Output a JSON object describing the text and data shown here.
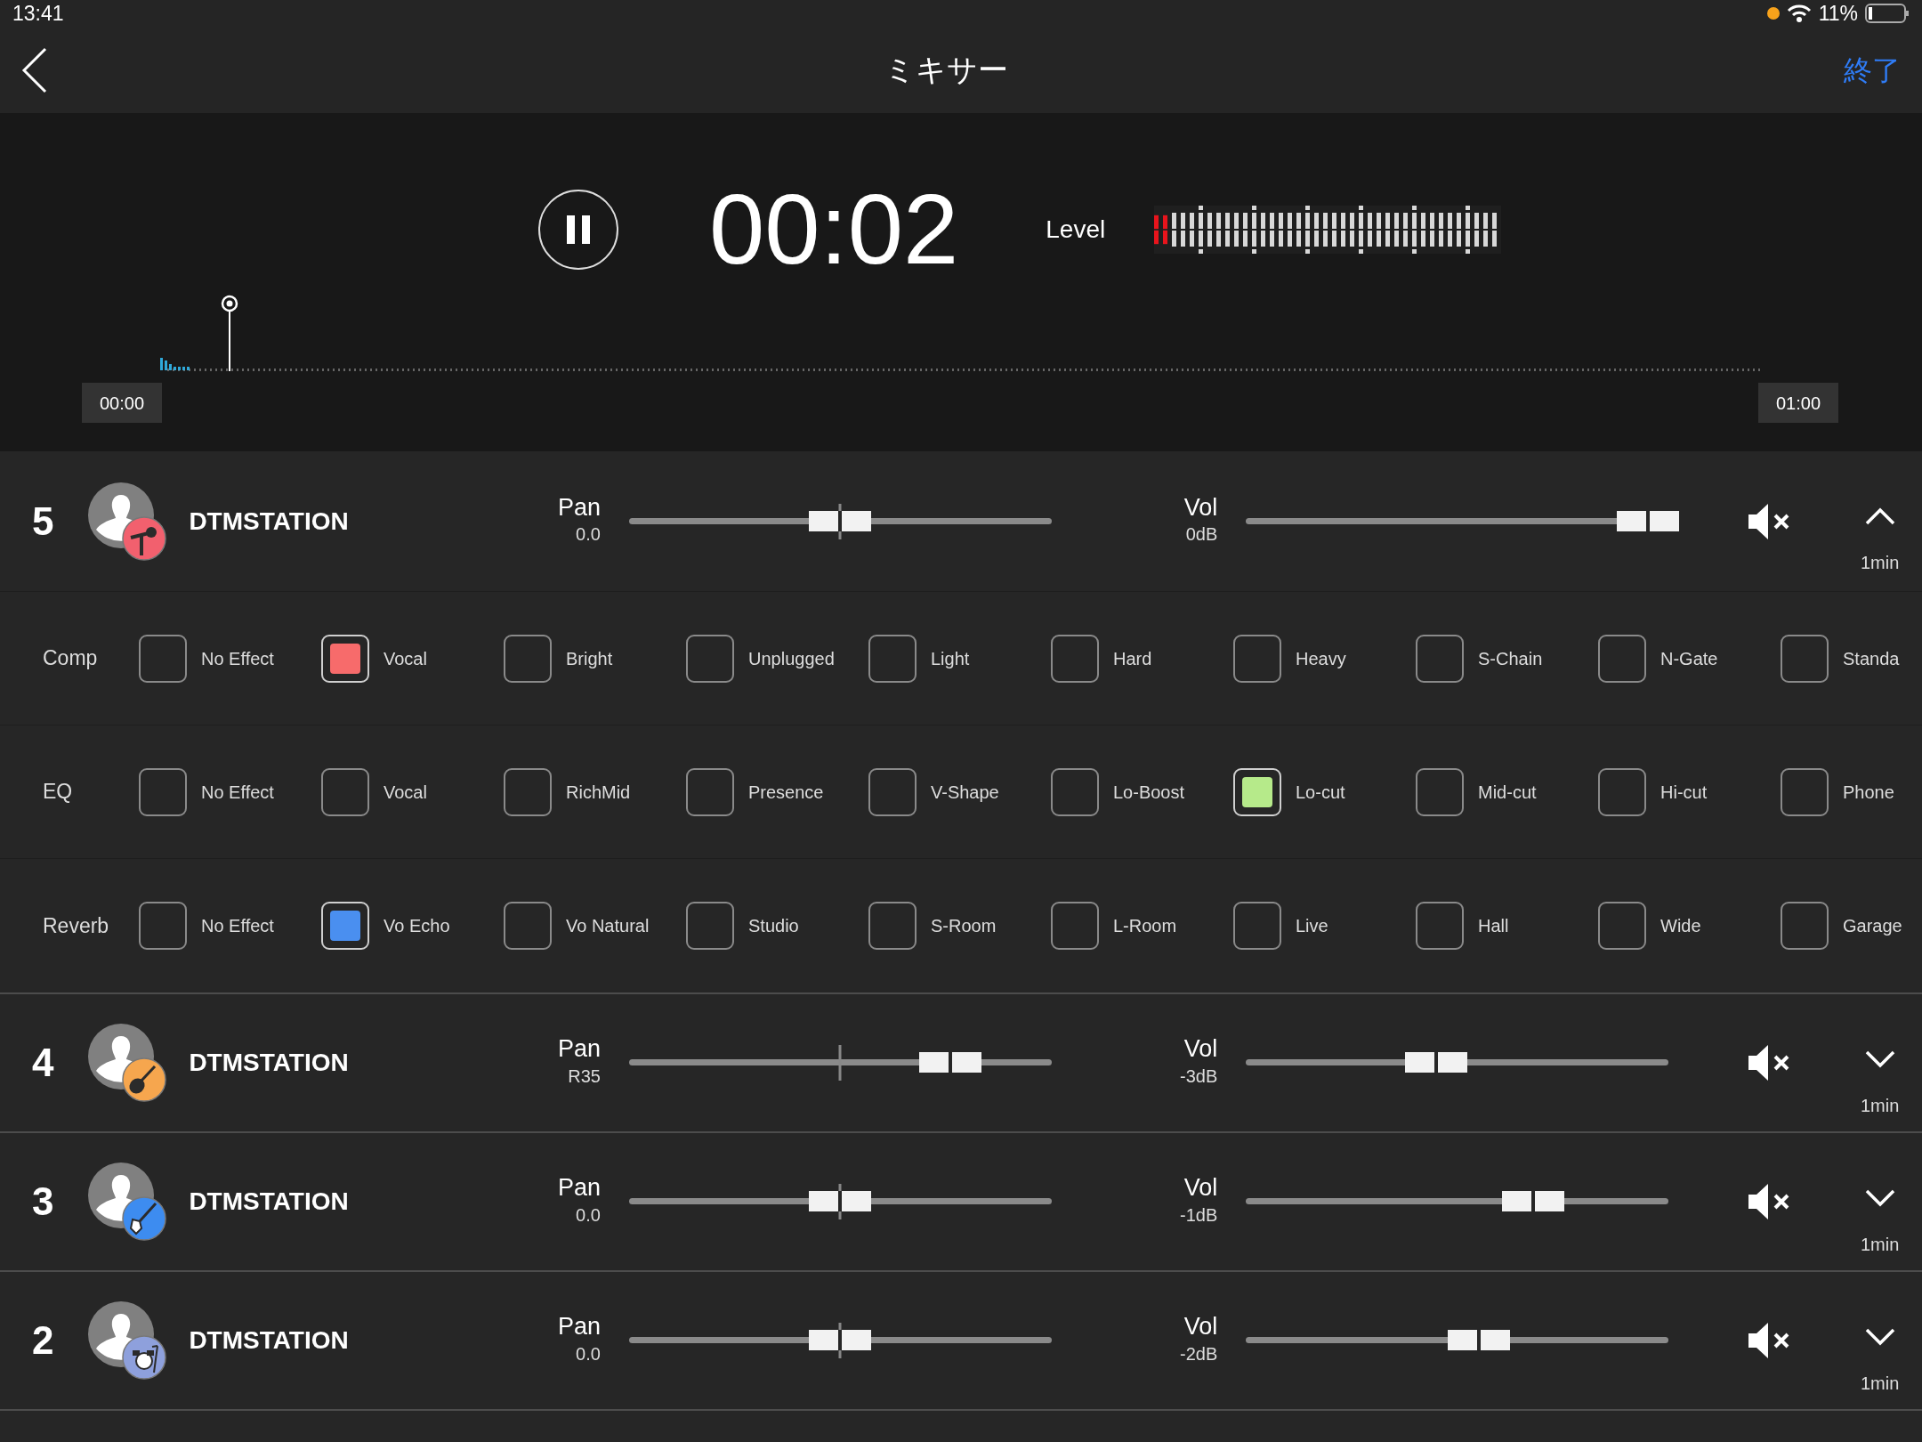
{
  "status_bar": {
    "time": "13:41",
    "battery": "11%"
  },
  "nav": {
    "title": "ミキサー",
    "done": "終了"
  },
  "transport": {
    "time": "00:02",
    "level_label": "Level",
    "meter": {
      "level": 0.05
    },
    "timeline": {
      "start": "00:00",
      "end": "01:00",
      "playhead": {
        "level": 0.04
      }
    }
  },
  "tracks": [
    {
      "number": "5",
      "name": "DTMSTATION",
      "kind": "mic",
      "color": "#f2606e",
      "pan": {
        "label": "Pan",
        "value": "0.0",
        "level": 0.5
      },
      "vol": {
        "label": "Vol",
        "value": "0dB",
        "level": 0.95
      },
      "duration": "1min",
      "expanded": true,
      "effects": [
        {
          "label": "Comp",
          "color": "#f76b6b",
          "options": [
            {
              "label": "No Effect",
              "selected": false
            },
            {
              "label": "Vocal",
              "selected": true
            },
            {
              "label": "Bright",
              "selected": false
            },
            {
              "label": "Unplugged",
              "selected": false
            },
            {
              "label": "Light",
              "selected": false
            },
            {
              "label": "Hard",
              "selected": false
            },
            {
              "label": "Heavy",
              "selected": false
            },
            {
              "label": "S-Chain",
              "selected": false
            },
            {
              "label": "N-Gate",
              "selected": false
            },
            {
              "label": "Standa",
              "selected": false
            }
          ]
        },
        {
          "label": "EQ",
          "color": "#b6ea8a",
          "options": [
            {
              "label": "No Effect",
              "selected": false
            },
            {
              "label": "Vocal",
              "selected": false
            },
            {
              "label": "RichMid",
              "selected": false
            },
            {
              "label": "Presence",
              "selected": false
            },
            {
              "label": "V-Shape",
              "selected": false
            },
            {
              "label": "Lo-Boost",
              "selected": false
            },
            {
              "label": "Lo-cut",
              "selected": true
            },
            {
              "label": "Mid-cut",
              "selected": false
            },
            {
              "label": "Hi-cut",
              "selected": false
            },
            {
              "label": "Phone",
              "selected": false
            }
          ]
        },
        {
          "label": "Reverb",
          "color": "#4a8ff0",
          "options": [
            {
              "label": "No Effect",
              "selected": false
            },
            {
              "label": "Vo Echo",
              "selected": true
            },
            {
              "label": "Vo Natural",
              "selected": false
            },
            {
              "label": "Studio",
              "selected": false
            },
            {
              "label": "S-Room",
              "selected": false
            },
            {
              "label": "L-Room",
              "selected": false
            },
            {
              "label": "Live",
              "selected": false
            },
            {
              "label": "Hall",
              "selected": false
            },
            {
              "label": "Wide",
              "selected": false
            },
            {
              "label": "Garage",
              "selected": false
            }
          ]
        }
      ]
    },
    {
      "number": "4",
      "name": "DTMSTATION",
      "kind": "guitar",
      "color": "#f6a64e",
      "pan": {
        "label": "Pan",
        "value": "R35",
        "level": 0.76
      },
      "vol": {
        "label": "Vol",
        "value": "-3dB",
        "level": 0.45
      },
      "duration": "1min",
      "expanded": false
    },
    {
      "number": "3",
      "name": "DTMSTATION",
      "kind": "electric-guitar",
      "color": "#3d8cf0",
      "pan": {
        "label": "Pan",
        "value": "0.0",
        "level": 0.5
      },
      "vol": {
        "label": "Vol",
        "value": "-1dB",
        "level": 0.68
      },
      "duration": "1min",
      "expanded": false
    },
    {
      "number": "2",
      "name": "DTMSTATION",
      "kind": "drums",
      "color": "#8ea0dc",
      "pan": {
        "label": "Pan",
        "value": "0.0",
        "level": 0.5
      },
      "vol": {
        "label": "Vol",
        "value": "-2dB",
        "level": 0.55
      },
      "duration": "1min",
      "expanded": false
    }
  ]
}
